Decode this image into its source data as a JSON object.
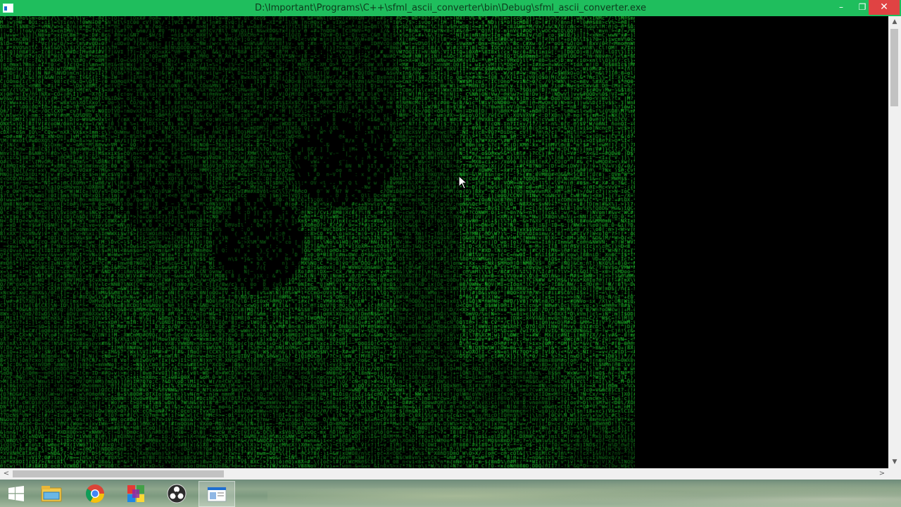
{
  "window": {
    "title": "D:\\Important\\Programs\\C++\\sfml_ascii_converter\\bin\\Debug\\sfml_ascii_converter.exe",
    "controls": {
      "minimize": "–",
      "maximize": "❐",
      "close": "✕"
    },
    "accent_color": "#1fbe5d"
  },
  "console": {
    "text_color": "#2ee53a",
    "background": "#000000",
    "glyphs": "#$%&*+=:;!?@~^\\/|()[]{}<>-_0O8ilIoQDwWmMnNxXvVcC"
  },
  "scrollbars": {
    "vertical": {
      "up": "▲",
      "down": "▼"
    },
    "horizontal": {
      "left": "<",
      "right": ">"
    }
  },
  "taskbar": {
    "items": [
      {
        "name": "start",
        "icon": "windows-logo-icon"
      },
      {
        "name": "file-explorer",
        "icon": "folder-icon"
      },
      {
        "name": "chrome",
        "icon": "chrome-icon"
      },
      {
        "name": "color-app",
        "icon": "colored-blocks-icon"
      },
      {
        "name": "obs",
        "icon": "obs-icon"
      },
      {
        "name": "console",
        "icon": "console-window-icon"
      }
    ]
  }
}
